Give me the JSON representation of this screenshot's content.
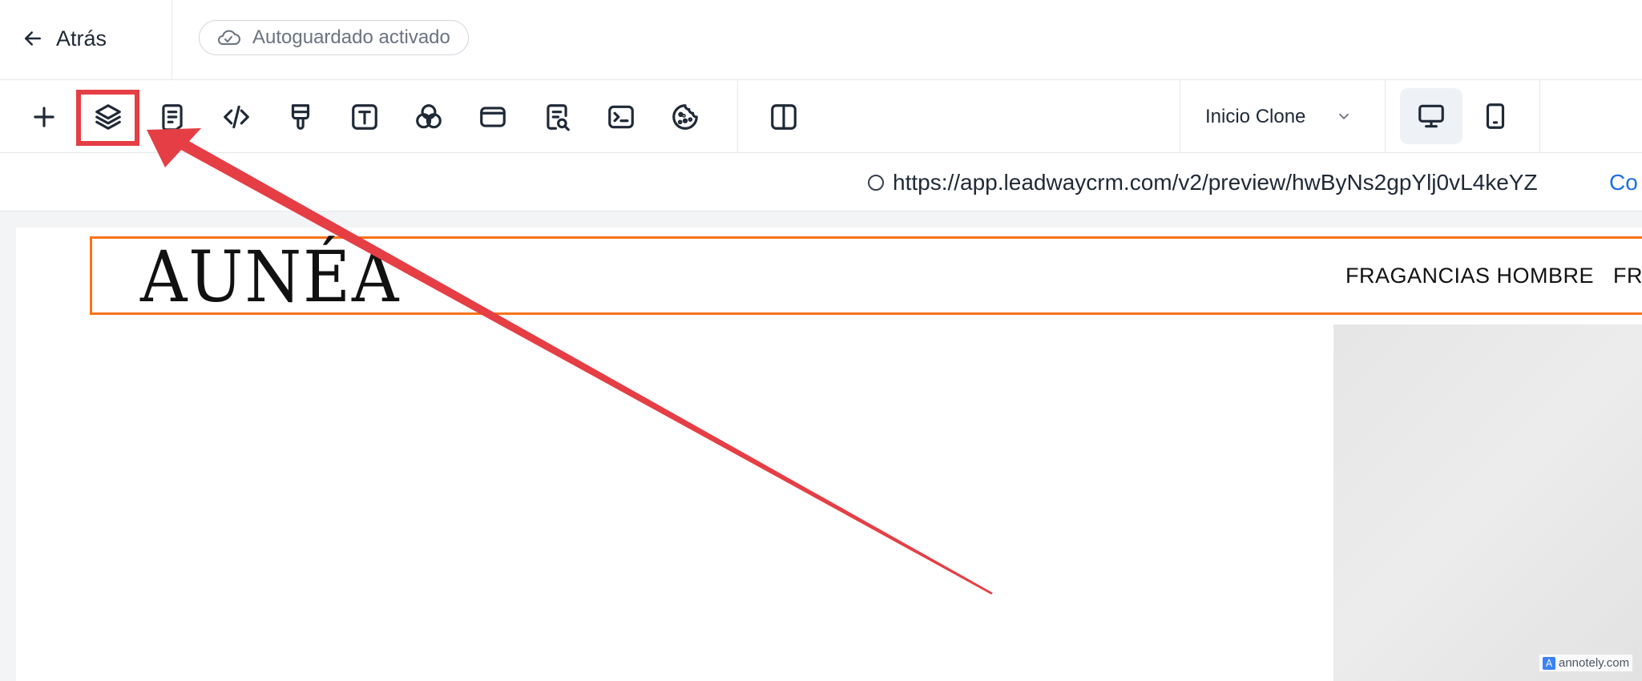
{
  "topbar": {
    "back_label": "Atrás",
    "autosave_label": "Autoguardado activado"
  },
  "toolbar": {
    "tools": [
      {
        "name": "add-element",
        "icon": "plus-icon"
      },
      {
        "name": "layers",
        "icon": "layers-icon"
      },
      {
        "name": "pages",
        "icon": "document-icon"
      },
      {
        "name": "code",
        "icon": "code-icon"
      },
      {
        "name": "styles",
        "icon": "paint-brush-icon"
      },
      {
        "name": "typography",
        "icon": "text-icon"
      },
      {
        "name": "colors",
        "icon": "color-circles-icon"
      },
      {
        "name": "sections",
        "icon": "window-icon"
      },
      {
        "name": "seo",
        "icon": "document-search-icon"
      },
      {
        "name": "tracking-code",
        "icon": "terminal-icon"
      },
      {
        "name": "cookies",
        "icon": "cookie-icon"
      },
      {
        "name": "split-view",
        "icon": "columns-icon"
      }
    ],
    "page_select_value": "Inicio Clone",
    "devices": [
      "desktop-icon",
      "mobile-icon"
    ]
  },
  "preview": {
    "url": "https://app.leadwaycrm.com/v2/preview/hwByNs2gpYlj0vL4keYZ",
    "url_link_partial": "Co"
  },
  "site": {
    "logo": "AUNÉA",
    "nav": [
      "FRAGANCIAS HOMBRE",
      "FRA"
    ]
  },
  "annotation": {
    "color": "#e53e45",
    "watermark": "annotely.com"
  },
  "colors": {
    "accent_orange": "#f97316",
    "link_blue": "#1d6fe8"
  }
}
